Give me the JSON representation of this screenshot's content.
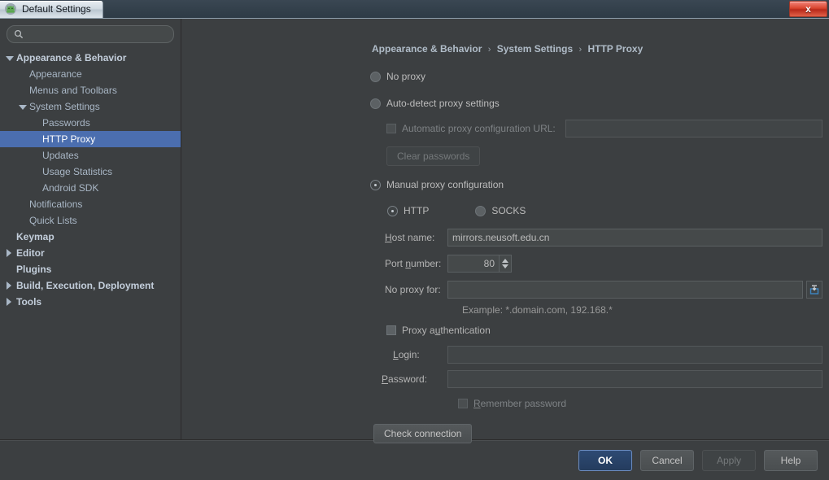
{
  "window": {
    "title": "Default Settings",
    "app_icon": "android-studio-icon",
    "close_label": "x"
  },
  "sidebar": {
    "search": {
      "value": "",
      "placeholder": "",
      "icon": "search-icon"
    },
    "items": [
      {
        "label": "Appearance & Behavior",
        "indent": 0,
        "twisty": "down",
        "bold": true,
        "selected": false
      },
      {
        "label": "Appearance",
        "indent": 1,
        "twisty": "none",
        "bold": false,
        "selected": false
      },
      {
        "label": "Menus and Toolbars",
        "indent": 1,
        "twisty": "none",
        "bold": false,
        "selected": false
      },
      {
        "label": "System Settings",
        "indent": 1,
        "twisty": "down",
        "bold": false,
        "selected": false
      },
      {
        "label": "Passwords",
        "indent": 2,
        "twisty": "none",
        "bold": false,
        "selected": false
      },
      {
        "label": "HTTP Proxy",
        "indent": 2,
        "twisty": "none",
        "bold": false,
        "selected": true
      },
      {
        "label": "Updates",
        "indent": 2,
        "twisty": "none",
        "bold": false,
        "selected": false
      },
      {
        "label": "Usage Statistics",
        "indent": 2,
        "twisty": "none",
        "bold": false,
        "selected": false
      },
      {
        "label": "Android SDK",
        "indent": 2,
        "twisty": "none",
        "bold": false,
        "selected": false
      },
      {
        "label": "Notifications",
        "indent": 1,
        "twisty": "none",
        "bold": false,
        "selected": false
      },
      {
        "label": "Quick Lists",
        "indent": 1,
        "twisty": "none",
        "bold": false,
        "selected": false
      },
      {
        "label": "Keymap",
        "indent": 0,
        "twisty": "none",
        "bold": true,
        "selected": false
      },
      {
        "label": "Editor",
        "indent": 0,
        "twisty": "right",
        "bold": true,
        "selected": false
      },
      {
        "label": "Plugins",
        "indent": 0,
        "twisty": "none",
        "bold": true,
        "selected": false
      },
      {
        "label": "Build, Execution, Deployment",
        "indent": 0,
        "twisty": "right",
        "bold": true,
        "selected": false
      },
      {
        "label": "Tools",
        "indent": 0,
        "twisty": "right",
        "bold": true,
        "selected": false
      }
    ]
  },
  "breadcrumb": {
    "part1": "Appearance & Behavior",
    "sep1": "›",
    "part2": "System Settings",
    "sep2": "›",
    "part3": "HTTP Proxy"
  },
  "form": {
    "no_proxy_label": "No proxy",
    "no_proxy_selected": false,
    "auto_detect_label": "Auto-detect proxy settings",
    "auto_detect_selected": false,
    "pac_checkbox_label": "Automatic proxy configuration URL:",
    "pac_checked": false,
    "pac_url_value": "",
    "clear_passwords_label": "Clear passwords",
    "clear_passwords_disabled": true,
    "manual_label": "Manual proxy configuration",
    "manual_selected": true,
    "http_label": "HTTP",
    "http_selected": true,
    "socks_label": "SOCKS",
    "socks_selected": false,
    "host_label_pre": "H",
    "host_label_post": "ost name:",
    "host_value": "mirrors.neusoft.edu.cn",
    "port_label_pre": "Port ",
    "port_label_mnem": "n",
    "port_label_post": "umber:",
    "port_value": "80",
    "noproxy_label": "No proxy for:",
    "noproxy_value": "",
    "expand_icon": "expand-field-icon",
    "example_hint": "Example: *.domain.com, 192.168.*",
    "proxy_auth_pre": "Proxy a",
    "proxy_auth_mnem": "u",
    "proxy_auth_post": "thentication",
    "proxy_auth_checked": false,
    "login_label_pre": "L",
    "login_label_post": "ogin:",
    "login_value": "",
    "password_label_pre": "P",
    "password_label_post": "assword:",
    "password_value": "",
    "remember_pre": "R",
    "remember_post": "emember password",
    "remember_checked": false,
    "remember_disabled": true,
    "check_connection_label": "Check connection"
  },
  "footer": {
    "ok_label": "OK",
    "cancel_label": "Cancel",
    "apply_label": "Apply",
    "apply_disabled": true,
    "help_label": "Help"
  },
  "colors": {
    "selection": "#4b6eaf",
    "panel": "#3c3f41",
    "titlebar": "#33404b",
    "close": "#d9452f",
    "text": "#bbbbbb",
    "tree_text": "#a9b7c6"
  }
}
